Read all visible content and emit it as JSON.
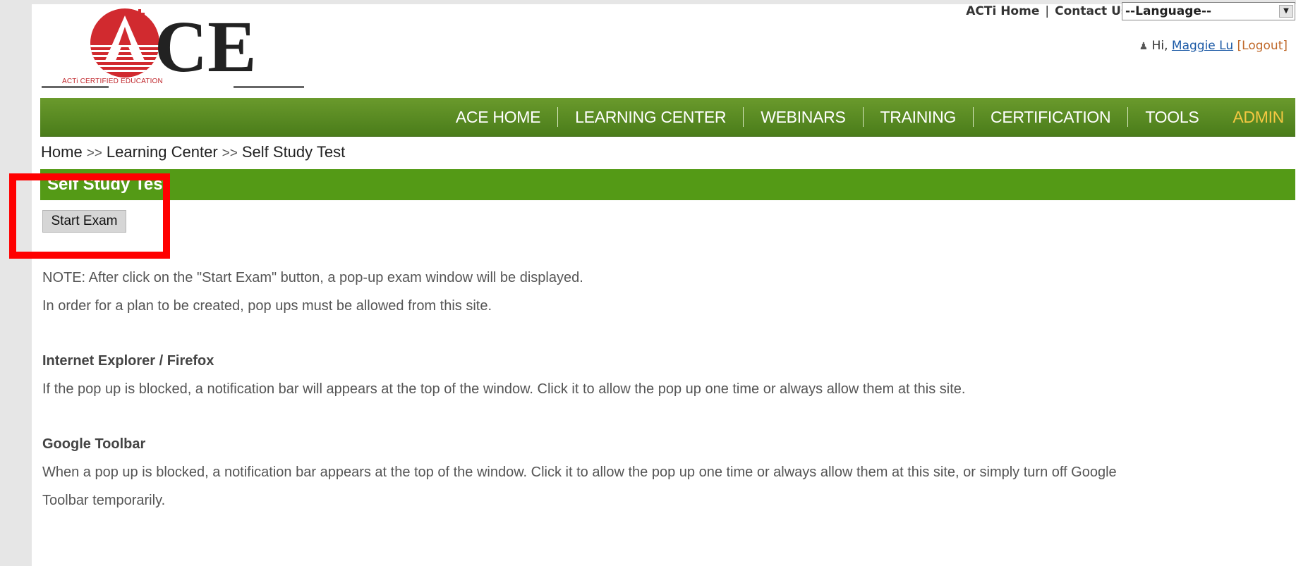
{
  "logo": {
    "text": "ACE",
    "tagline": "ACTi CERTIFIED EDUCATION"
  },
  "top_links": {
    "home": "ACTi Home",
    "contact": "Contact Us",
    "separator": "|"
  },
  "language_select": {
    "selected": "--Language--"
  },
  "user": {
    "greeting": "Hi,",
    "name": "Maggie Lu",
    "logout": "[Logout]"
  },
  "nav": {
    "items": [
      {
        "label": "ACE HOME"
      },
      {
        "label": "LEARNING CENTER"
      },
      {
        "label": "WEBINARS"
      },
      {
        "label": "TRAINING"
      },
      {
        "label": "CERTIFICATION"
      },
      {
        "label": "TOOLS"
      },
      {
        "label": "ADMIN"
      }
    ]
  },
  "breadcrumb": {
    "items": [
      "Home",
      "Learning Center",
      "Self Study Test"
    ],
    "separator": ">>"
  },
  "section": {
    "title": "Self Study Test"
  },
  "start_button": {
    "label": "Start Exam"
  },
  "content": {
    "note_line1": "NOTE: After click on the \"Start Exam\" button, a pop-up exam window will be displayed.",
    "note_line2": "In order for a plan to be created, pop ups must be allowed from this site.",
    "ie_heading": "Internet Explorer / Firefox",
    "ie_text": "If the pop up is blocked, a notification bar will appears at the top of the window. Click it to allow the pop up one time or always allow them at this site.",
    "google_heading": "Google Toolbar",
    "google_text_line1": "When a pop up is blocked, a notification bar appears at the top of the window. Click it to allow the pop up one time or always allow them at this site, or simply turn off Google",
    "google_text_line2": "Toolbar temporarily."
  },
  "colors": {
    "nav_green": "#5a8c22",
    "section_green": "#549a16",
    "admin_yellow": "#f5c842",
    "logo_red": "#c0282d",
    "highlight_red": "#ff0000"
  }
}
